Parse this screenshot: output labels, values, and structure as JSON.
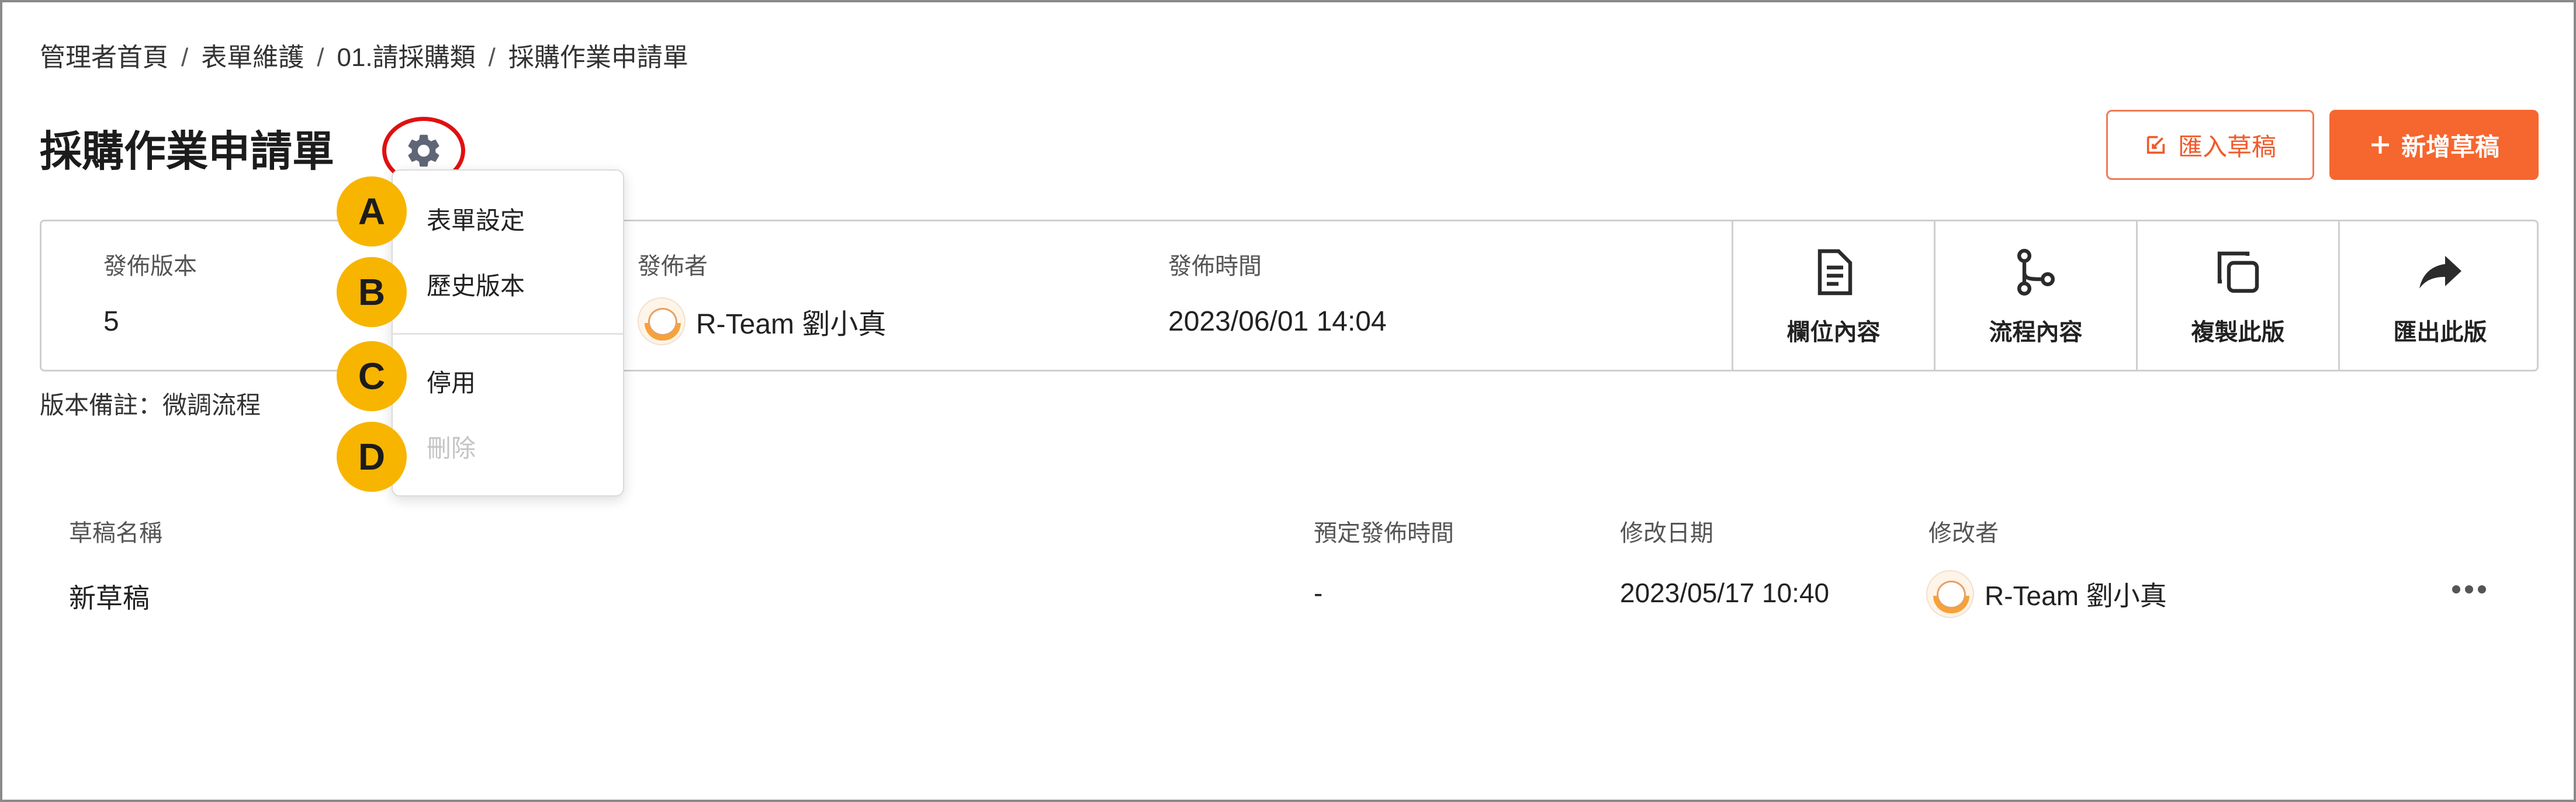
{
  "breadcrumb": {
    "items": [
      "管理者首頁",
      "表單維護",
      "01.請採購類",
      "採購作業申請單"
    ],
    "separator": "/"
  },
  "page": {
    "title": "採購作業申請單",
    "settings_icon": "gear-icon"
  },
  "header_buttons": {
    "import_label": "匯入草稿",
    "import_icon": "import-icon",
    "new_label": "新增草稿",
    "new_icon": "plus-icon"
  },
  "info": {
    "version_label": "發佈版本",
    "version_value": "5",
    "publisher_label": "發佈者",
    "publisher_value": "R-Team 劉小真",
    "time_label": "發佈時間",
    "time_value": "2023/06/01 14:04"
  },
  "actions": [
    {
      "label": "欄位內容",
      "icon": "document-icon"
    },
    {
      "label": "流程內容",
      "icon": "flow-icon"
    },
    {
      "label": "複製此版",
      "icon": "copy-icon"
    },
    {
      "label": "匯出此版",
      "icon": "share-arrow-icon"
    }
  ],
  "version_note": "版本備註：微調流程",
  "dropdown": {
    "items": [
      {
        "label": "表單設定",
        "marker": "A",
        "enabled": true
      },
      {
        "label": "歷史版本",
        "marker": "B",
        "enabled": true
      },
      {
        "label": "停用",
        "marker": "C",
        "enabled": true
      },
      {
        "label": "刪除",
        "marker": "D",
        "enabled": false
      }
    ]
  },
  "table": {
    "headers": [
      "草稿名稱",
      "預定發佈時間",
      "修改日期",
      "修改者"
    ],
    "rows": [
      {
        "name": "新草稿",
        "scheduled": "-",
        "modified": "2023/05/17 10:40",
        "modifier": "R-Team 劉小真"
      }
    ]
  },
  "colors": {
    "accent": "#f6662f",
    "highlight_circle": "#e01010",
    "marker": "#f7b500",
    "disabled_text": "#c4c4c4"
  }
}
